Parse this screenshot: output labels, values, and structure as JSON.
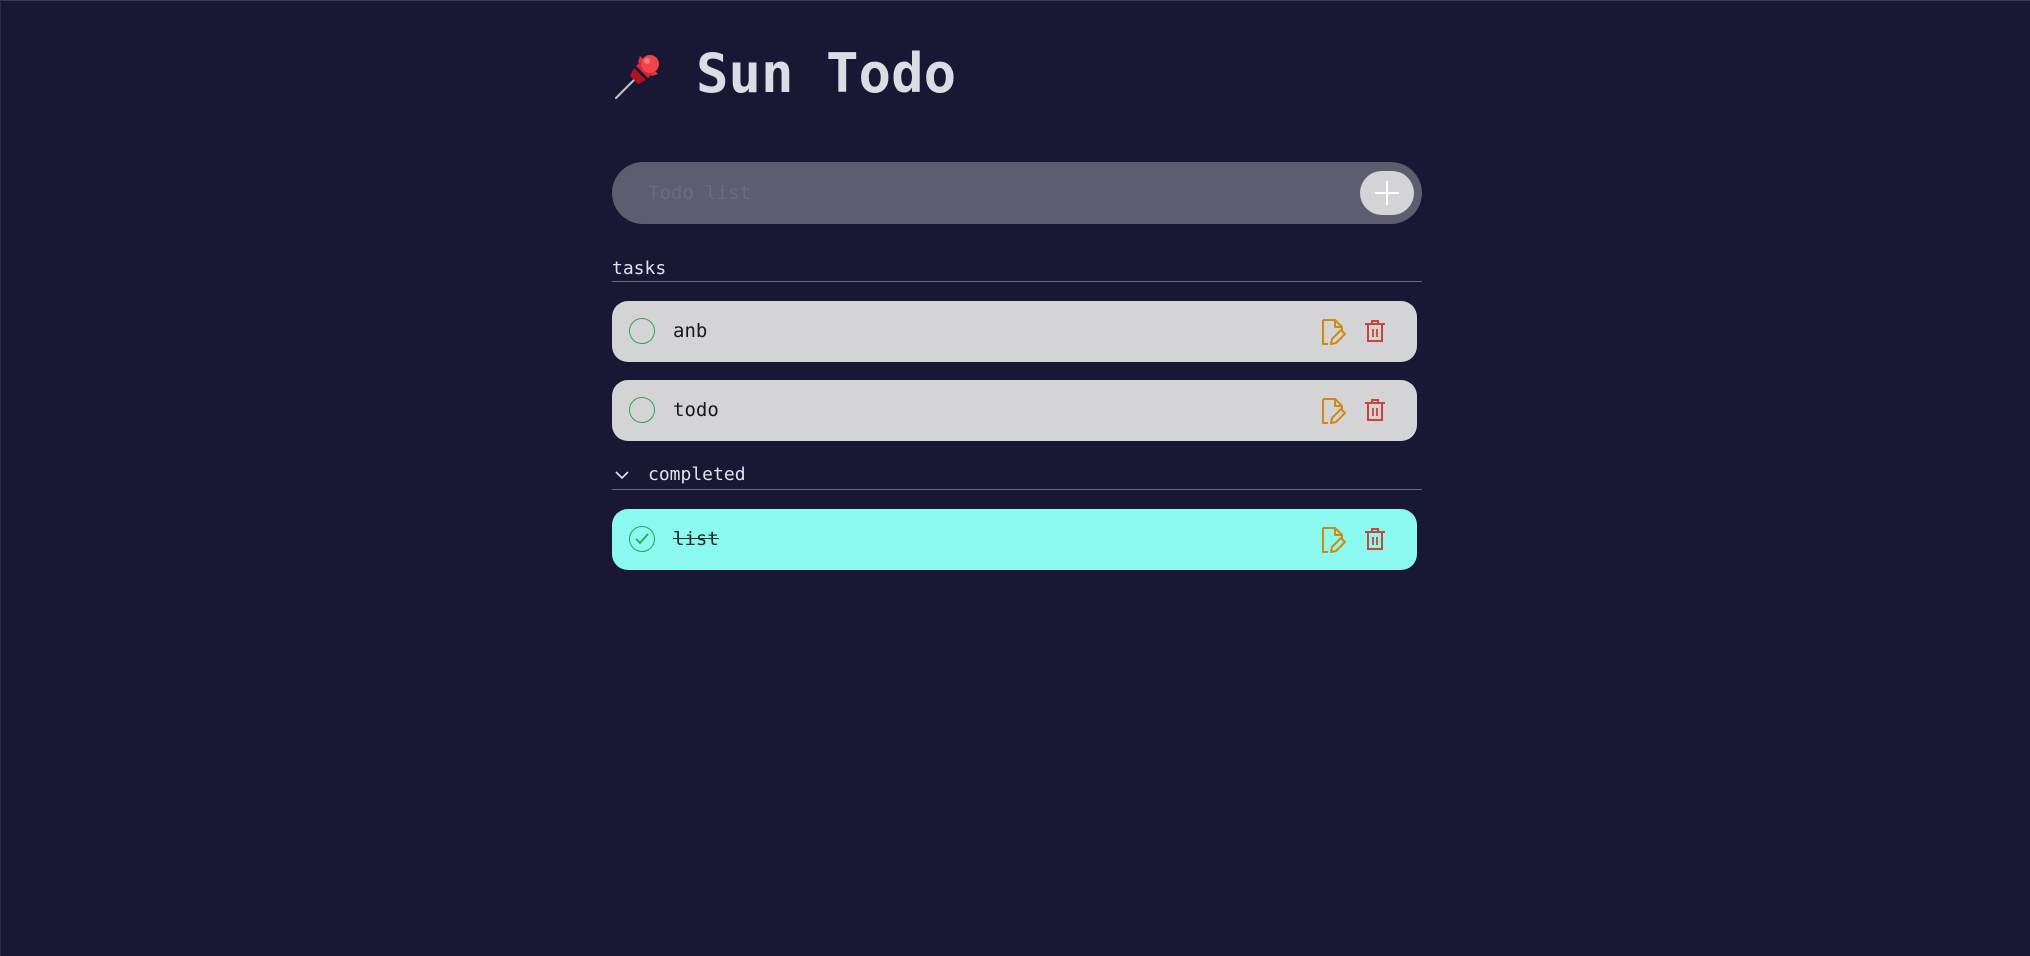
{
  "app": {
    "title": "Sun Todo",
    "title_icon": "pushpin-icon"
  },
  "add_form": {
    "placeholder": "Todo list",
    "value": "",
    "button_icon": "plus-icon"
  },
  "sections": {
    "tasks_label": "tasks",
    "completed_label": "completed",
    "completed_expanded": true
  },
  "tasks": [
    {
      "text": "anb",
      "completed": false
    },
    {
      "text": "todo",
      "completed": false
    }
  ],
  "completed": [
    {
      "text": "list",
      "completed": true
    }
  ],
  "colors": {
    "background": "#181834",
    "task_card": "#d4d4d6",
    "completed_card": "#8bf9ef",
    "check_green": "#2fa44f",
    "edit_orange": "#d08a12",
    "delete_red": "#c8453c"
  }
}
